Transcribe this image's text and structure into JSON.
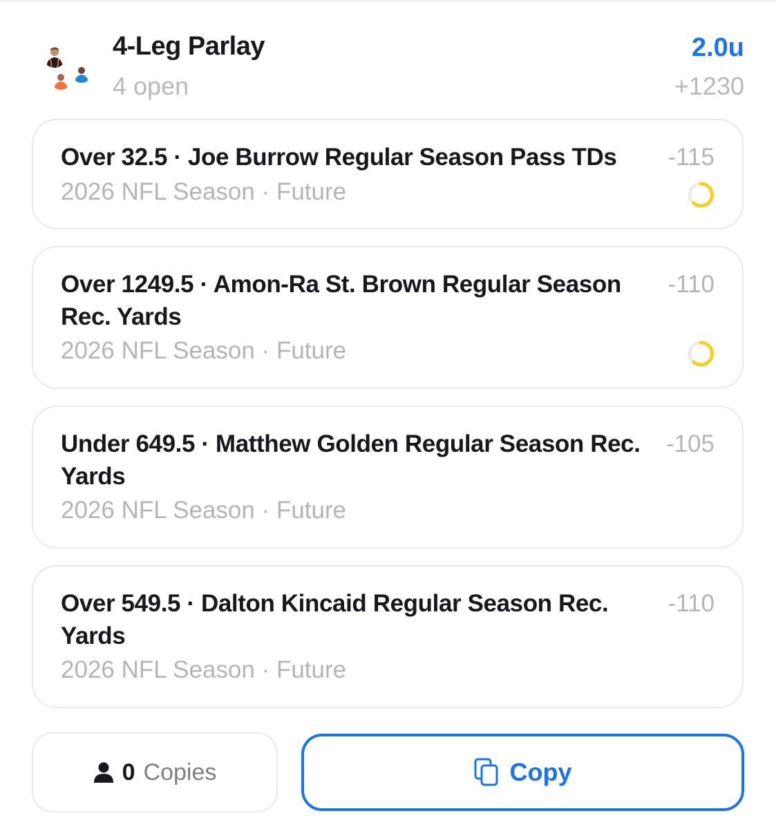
{
  "header": {
    "title": "4-Leg Parlay",
    "subtitle": "4 open",
    "units": "2.0u",
    "odds": "+1230"
  },
  "legs": [
    {
      "title": "Over 32.5 · Joe Burrow Regular Season Pass TDs",
      "odds": "-115",
      "subtitle": "2026 NFL Season · Future",
      "status": "in-progress-ring-icon"
    },
    {
      "title": "Over 1249.5 · Amon-Ra St. Brown Regular Season Rec. Yards",
      "odds": "-110",
      "subtitle": "2026 NFL Season · Future",
      "status": "in-progress-ring-icon"
    },
    {
      "title": "Under 649.5 · Matthew Golden Regular Season Rec. Yards",
      "odds": "-105",
      "subtitle": "2026 NFL Season · Future",
      "status": ""
    },
    {
      "title": "Over 549.5 · Dalton Kincaid Regular Season Rec. Yards",
      "odds": "-110",
      "subtitle": "2026 NFL Season · Future",
      "status": ""
    }
  ],
  "footer": {
    "copies_count": "0",
    "copies_label": "Copies",
    "copy_button_label": "Copy"
  },
  "colors": {
    "accent": "#1a73e8",
    "muted_text": "#b3b4b9",
    "status_ring": "#f4cf24"
  }
}
